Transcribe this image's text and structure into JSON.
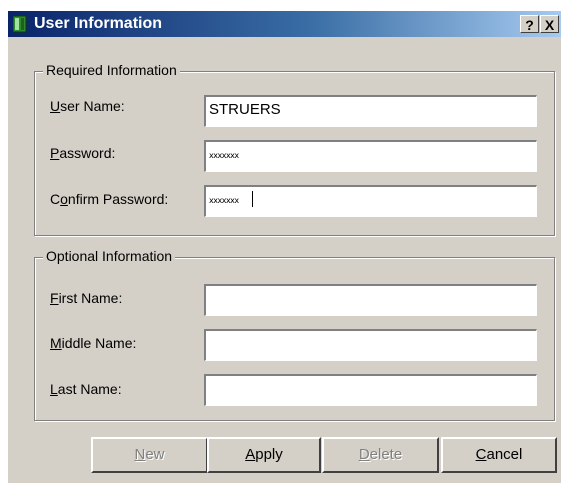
{
  "window": {
    "title": "User Information",
    "help_label": "?",
    "close_label": "X"
  },
  "required": {
    "legend": "Required Information",
    "username": {
      "label_key": "U",
      "label_rest": "ser Name:",
      "value": "STRUERS"
    },
    "password": {
      "label_key": "P",
      "label_rest": "assword:",
      "value": "xxxxxxx"
    },
    "confirm": {
      "label_pre": "C",
      "label_key": "o",
      "label_rest": "nfirm Password:",
      "value": "xxxxxxx"
    }
  },
  "optional": {
    "legend": "Optional Information",
    "first": {
      "label_key": "F",
      "label_rest": "irst Name:",
      "value": ""
    },
    "middle": {
      "label_key": "M",
      "label_rest": "iddle Name:",
      "value": ""
    },
    "last": {
      "label_key": "L",
      "label_rest": "ast Name:",
      "value": ""
    }
  },
  "buttons": {
    "new": {
      "key": "N",
      "rest": "ew",
      "enabled": false
    },
    "apply": {
      "key": "A",
      "rest": "pply",
      "enabled": true
    },
    "delete": {
      "key": "D",
      "rest": "elete",
      "enabled": false
    },
    "cancel": {
      "key": "C",
      "rest": "ancel",
      "enabled": true
    }
  },
  "colors": {
    "face": "#d4d0c8",
    "title_start": "#0a246a",
    "title_end": "#a6caf0",
    "disabled_text": "#808080"
  },
  "icons": {
    "title": "app-icon",
    "help": "help-icon",
    "close": "close-icon"
  }
}
